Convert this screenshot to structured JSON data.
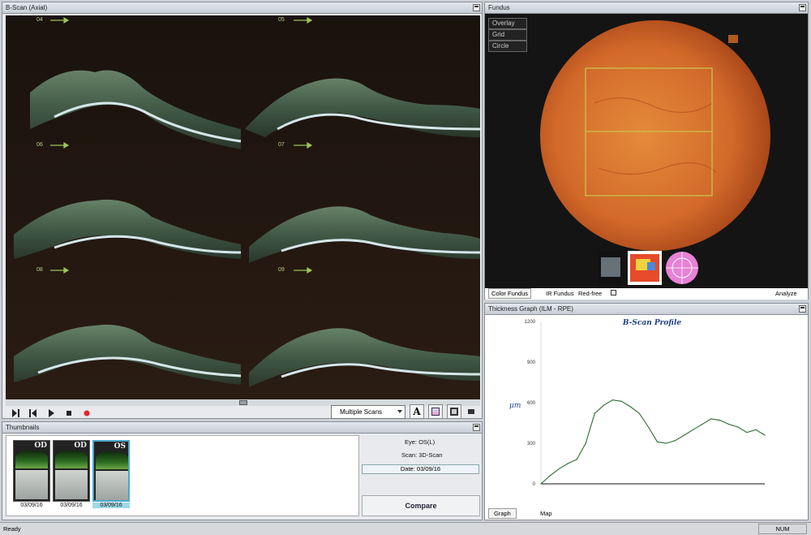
{
  "bscan": {
    "title": "B-Scan (Axial)",
    "tile_labels": [
      "04",
      "05",
      "06",
      "07",
      "08",
      "09"
    ],
    "view_mode": "Multiple Scans",
    "font_button": "A"
  },
  "fundus": {
    "title": "Fundus",
    "menu": [
      "Overlay",
      "Grid",
      "Circle"
    ],
    "tabs": {
      "color_fundus": "Color Fundus",
      "ir_fundus": "IR Fundus",
      "red_free": "Red-free",
      "analyze": "Analyze"
    }
  },
  "graph": {
    "title": "Thickness Graph   (ILM - RPE)",
    "plot_title": "B-Scan Profile",
    "ylabel": "μm",
    "tabs": {
      "graph": "Graph",
      "map": "Map"
    }
  },
  "chart_data": {
    "type": "line",
    "title": "B-Scan Profile",
    "xlabel": "",
    "ylabel": "μm",
    "ylim": [
      0,
      1200
    ],
    "yticks": [
      "0",
      "300",
      "600",
      "900",
      "1200"
    ],
    "x": [
      0,
      4,
      8,
      12,
      16,
      20,
      24,
      28,
      32,
      36,
      40,
      44,
      48,
      52,
      56,
      60,
      64,
      68,
      72,
      76,
      80,
      84,
      88,
      92,
      96,
      100
    ],
    "series": [
      {
        "values": [
          0,
          60,
          110,
          150,
          180,
          300,
          520,
          580,
          620,
          610,
          570,
          520,
          420,
          310,
          300,
          320,
          360,
          400,
          440,
          480,
          470,
          440,
          420,
          380,
          400,
          360
        ],
        "color": "#2a6e2a"
      }
    ]
  },
  "thumbnails": {
    "title": "Thumbnails",
    "items": [
      {
        "eye": "OD",
        "date": "03/09/16"
      },
      {
        "eye": "OD",
        "date": "03/09/16"
      },
      {
        "eye": "OS",
        "date": "03/09/16"
      }
    ],
    "eye_info": "Eye: OS(L)",
    "scan_info": "Scan: 3D-Scan",
    "date_info": "Date: 03/09/16",
    "compare_label": "Compare"
  },
  "status": {
    "ready": "Ready",
    "num": "NUM"
  }
}
